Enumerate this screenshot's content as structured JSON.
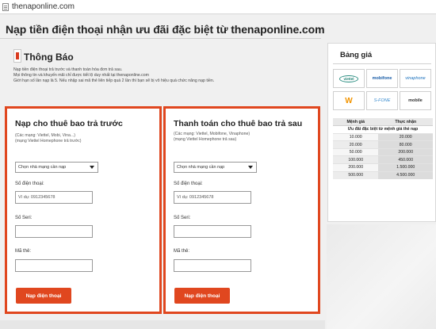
{
  "browser": {
    "url": "thenaponline.com"
  },
  "page": {
    "title": "Nạp tiền điện thoại nhận ưu đãi đặc biệt từ thenaponline.com"
  },
  "notice": {
    "title": "Thông Báo",
    "lines": [
      "Nạp tiền điện thoại trả trước và thanh toán hóa đơn trả sau.",
      "Mọi thông tin và khuyến mãi chỉ được tiết lộ duy nhất tại thenaponline.com",
      "Giới hạn số lần nạp là 5. Nếu nhập sai mã thẻ liên tiếp quá 2 lần thì bạn sẽ bị vô hiệu quá chức năng nạp tiền."
    ]
  },
  "prepaid": {
    "heading": "Nạp cho thuê bao trả trước",
    "sub1": "(Các mạng: Viettel, Mobi, Vina...)",
    "sub2": "(mạng Viettel Homephone trả trước)",
    "network_select": "Chọn nhà mạng cần nạp",
    "phone_label": "Số điện thoại:",
    "phone_placeholder": "Ví dụ: 0912345678",
    "serial_label": "Số Seri:",
    "card_label": "Mã thẻ:",
    "submit": "Nạp điện thoại"
  },
  "postpaid": {
    "heading": "Thanh toán cho thuê bao trả sau",
    "sub1": "(Các mạng: Viettel, Mobifone, Vinaphone)",
    "sub2": "(mạng Viettel Homephone trả sau)",
    "network_select": "Chọn nhà mạng cần nạp",
    "phone_label": "Số điện thoại:",
    "phone_placeholder": "Ví dụ: 0912345678",
    "serial_label": "Số Seri:",
    "card_label": "Mã thẻ:",
    "submit": "Nạp điện thoại"
  },
  "pricing": {
    "title": "Bảng giá",
    "logos": [
      "viettel",
      "mobifone",
      "vinaphone",
      "W",
      "S-FONE",
      "mobile"
    ],
    "col_denomination": "Mệnh giá",
    "col_received": "Thực nhận",
    "special_row": "Ưu đãi đặc biệt từ mệnh giá thẻ nạp",
    "rows": [
      {
        "denomination": "10.000",
        "received": "20.000"
      },
      {
        "denomination": "20.000",
        "received": "80.000"
      },
      {
        "denomination": "50.000",
        "received": "200.000"
      },
      {
        "denomination": "100.000",
        "received": "450.000"
      },
      {
        "denomination": "200.000",
        "received": "1.500.000"
      },
      {
        "denomination": "500.000",
        "received": "4.500.000"
      }
    ]
  },
  "colors": {
    "accent": "#e0471f",
    "page_bg": "#f0f0f0"
  }
}
